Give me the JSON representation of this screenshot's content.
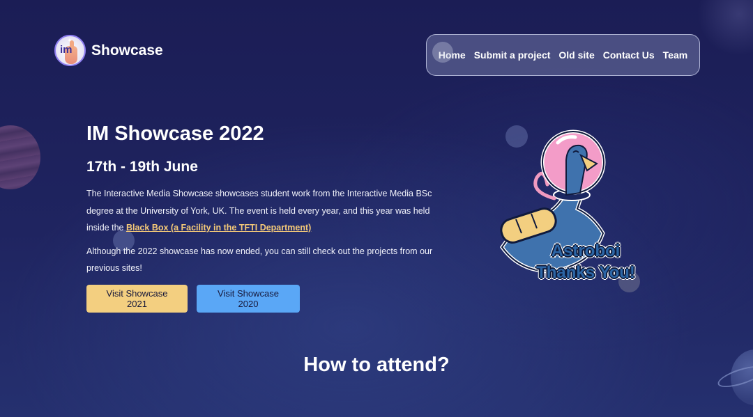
{
  "brand": {
    "name": "Showcase",
    "logo_text": "im",
    "logo_icon": "pointing-hand-logo"
  },
  "nav": {
    "items": [
      {
        "label": "Home"
      },
      {
        "label": "Submit a project"
      },
      {
        "label": "Old site"
      },
      {
        "label": "Contact Us"
      },
      {
        "label": "Team"
      }
    ]
  },
  "hero": {
    "title": "IM Showcase 2022",
    "dates": "17th - 19th June",
    "para1_text": "The Interactive Media Showcase showcases student work from the Interactive Media BSc degree at the University of York, UK. The event is held every year, and this year was held inside the ",
    "para1_link": "Black Box (a Facility in the TFTI Department)",
    "para2": "Although the 2022 showcase has now ended, you can still check out the projects from our previous sites!",
    "buttons": {
      "btn2021": "Visit Showcase 2021",
      "btn2020": "Visit Showcase 2020"
    }
  },
  "sticker": {
    "line1": "Astroboi",
    "line2": "Thanks You!",
    "icon": "astronaut-bird-sticker"
  },
  "attend": {
    "heading": "How to attend?"
  },
  "colors": {
    "background": "#1d2058",
    "gold": "#f3cf80",
    "blue": "#5aa7f6",
    "link": "#f4c978"
  }
}
